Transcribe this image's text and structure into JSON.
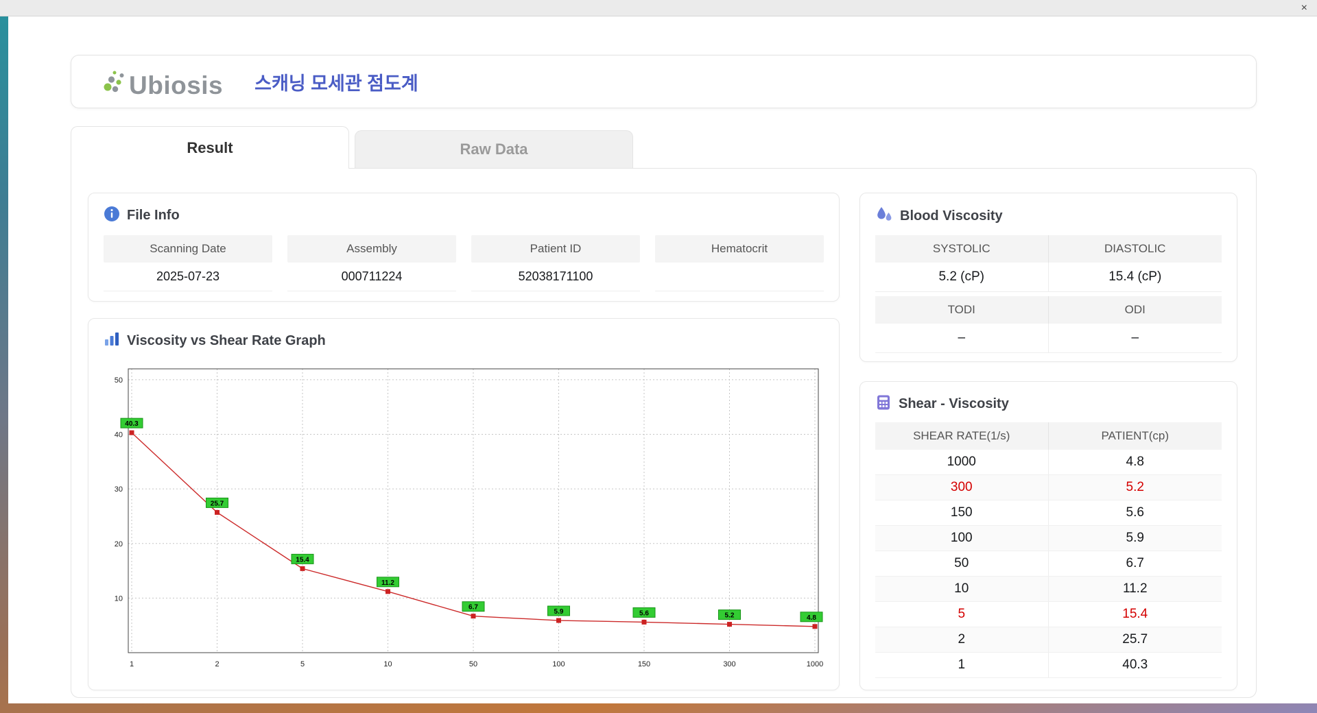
{
  "window": {
    "close": "×"
  },
  "header": {
    "logo": "Ubiosis",
    "title": "스캐닝 모세관 점도계"
  },
  "tabs": {
    "result": "Result",
    "raw_data": "Raw Data"
  },
  "file_info": {
    "title": "File Info",
    "fields": [
      {
        "label": "Scanning Date",
        "value": "2025-07-23"
      },
      {
        "label": "Assembly",
        "value": "000711224"
      },
      {
        "label": "Patient ID",
        "value": "52038171100"
      },
      {
        "label": "Hematocrit",
        "value": ""
      }
    ]
  },
  "blood_viscosity": {
    "title": "Blood Viscosity",
    "groups": [
      {
        "cols": [
          {
            "label": "SYSTOLIC",
            "value": "5.2 (cP)"
          },
          {
            "label": "DIASTOLIC",
            "value": "15.4 (cP)"
          }
        ]
      },
      {
        "cols": [
          {
            "label": "TODI",
            "value": "–"
          },
          {
            "label": "ODI",
            "value": "–"
          }
        ]
      }
    ]
  },
  "shear_viscosity": {
    "title": "Shear - Viscosity",
    "columns": [
      "SHEAR RATE(1/s)",
      "PATIENT(cp)"
    ],
    "rows": [
      {
        "shear": "1000",
        "patient": "4.8",
        "highlight": false
      },
      {
        "shear": "300",
        "patient": "5.2",
        "highlight": true
      },
      {
        "shear": "150",
        "patient": "5.6",
        "highlight": false
      },
      {
        "shear": "100",
        "patient": "5.9",
        "highlight": false
      },
      {
        "shear": "50",
        "patient": "6.7",
        "highlight": false
      },
      {
        "shear": "10",
        "patient": "11.2",
        "highlight": false
      },
      {
        "shear": "5",
        "patient": "15.4",
        "highlight": true
      },
      {
        "shear": "2",
        "patient": "25.7",
        "highlight": false
      },
      {
        "shear": "1",
        "patient": "40.3",
        "highlight": false
      }
    ]
  },
  "graph": {
    "title": "Viscosity vs Shear Rate Graph"
  },
  "chart_data": {
    "type": "line",
    "title": "Viscosity vs Shear Rate Graph",
    "x_axis_type": "category",
    "categories": [
      "1",
      "2",
      "5",
      "10",
      "50",
      "100",
      "150",
      "300",
      "1000"
    ],
    "values": [
      40.3,
      25.7,
      15.4,
      11.2,
      6.7,
      5.9,
      5.6,
      5.2,
      4.8
    ],
    "xlabel": "",
    "ylabel": "",
    "ylim": [
      0,
      52
    ],
    "yticks": [
      10,
      20,
      30,
      40,
      50
    ],
    "grid": true,
    "legend": false,
    "line_color": "#cc2a2a",
    "marker_color": "#cc2222",
    "label_bg": "#33cc33",
    "label_border": "#189418"
  },
  "colors": {
    "accent_blue": "#4a5cc5",
    "highlight_red": "#d40000",
    "label_green": "#33cc33",
    "header_gray": "#f4f4f4"
  }
}
